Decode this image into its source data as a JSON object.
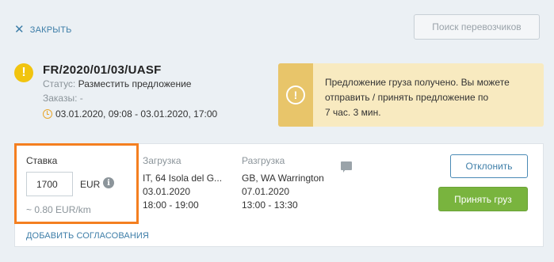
{
  "header": {
    "close_label": "ЗАКРЫТЬ",
    "search_carriers_label": "Поиск перевозчиков"
  },
  "order": {
    "id": "FR/2020/01/03/UASF",
    "status_label": "Статус:",
    "status_value": "Разместить предложение",
    "orders_label": "Заказы: -",
    "time_window": "03.01.2020, 09:08 - 03.01.2020, 17:00"
  },
  "notice": {
    "line1": "Предложение груза получено. Вы можете",
    "line2": "отправить / принять предложение по",
    "line3": "7 час. 3 мин."
  },
  "rate": {
    "label": "Ставка",
    "value": "1700",
    "currency": "EUR",
    "per_km": "~ 0.80  EUR/km"
  },
  "loading": {
    "heading": "Загрузка",
    "place": "IT, 64 Isola del G...",
    "date": "03.01.2020",
    "time": "18:00 - 19:00"
  },
  "unloading": {
    "heading": "Разгрузка",
    "place": "GB, WA Warrington",
    "date": "07.01.2020",
    "time": "13:00 - 13:30"
  },
  "actions": {
    "decline_label": "Отклонить",
    "accept_label": "Принять груз",
    "add_agreements_label": "ДОБАВИТЬ СОГЛАСОВАНИЯ"
  },
  "icons": {
    "close": "close-icon",
    "warning": "warning-icon",
    "clock": "clock-icon",
    "notice_alert": "alert-icon",
    "info": "info-icon",
    "comment": "comment-icon"
  },
  "colors": {
    "accent_blue": "#3e7ea8",
    "warning_yellow": "#f1c40f",
    "highlight_orange": "#f47f20",
    "accept_green": "#79b43e",
    "notice_bg": "#f8eac0"
  }
}
